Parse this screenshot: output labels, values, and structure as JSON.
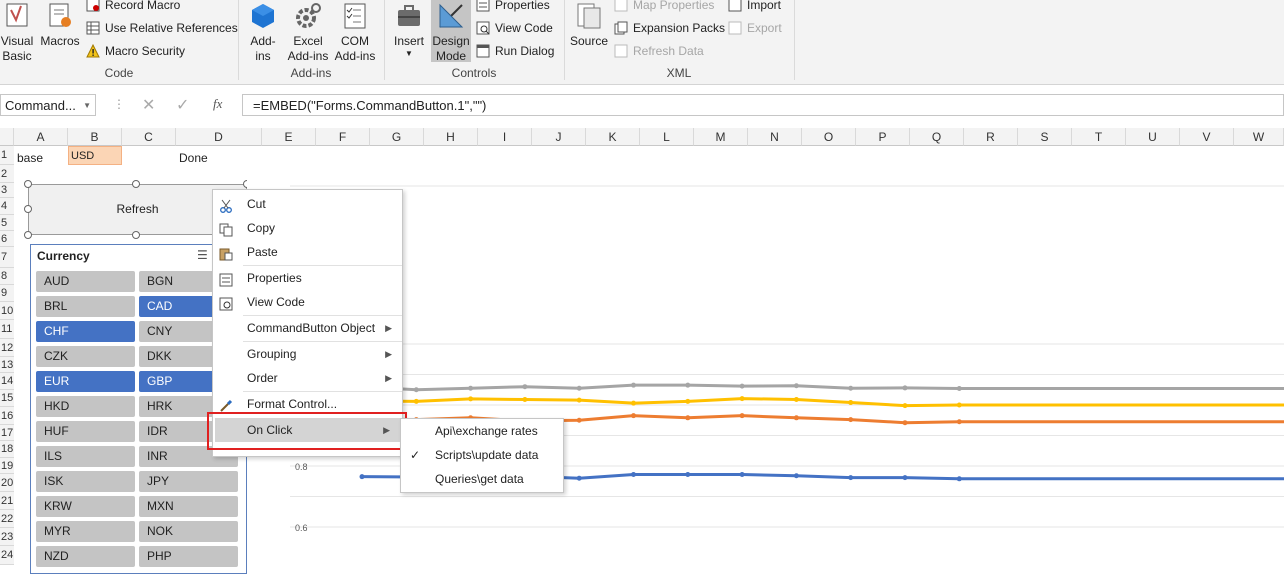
{
  "ribbon": {
    "code": {
      "label": "Code",
      "visual_basic": "Visual\nBasic",
      "macros": "Macros",
      "record_macro": "Record Macro",
      "use_relative_references": "Use Relative References",
      "macro_security": "Macro Security"
    },
    "addins": {
      "label": "Add-ins",
      "addins": "Add-\nins",
      "excel_addins": "Excel\nAdd-ins",
      "com_addins": "COM\nAdd-ins"
    },
    "controls": {
      "label": "Controls",
      "insert": "Insert",
      "design_mode": "Design\nMode",
      "properties": "Properties",
      "view_code": "View Code",
      "run_dialog": "Run Dialog"
    },
    "xml": {
      "label": "XML",
      "source": "Source",
      "map_properties": "Map Properties",
      "expansion_packs": "Expansion Packs",
      "refresh_data": "Refresh Data",
      "import": "Import",
      "export": "Export"
    }
  },
  "formula_bar": {
    "name_box": "Command...",
    "fx": "fx",
    "formula": "=EMBED(\"Forms.CommandButton.1\",\"\")"
  },
  "columns": [
    "A",
    "B",
    "C",
    "D",
    "E",
    "F",
    "G",
    "H",
    "I",
    "J",
    "K",
    "L",
    "M",
    "N",
    "O",
    "P",
    "Q",
    "R",
    "S",
    "T",
    "U",
    "V",
    "W"
  ],
  "rows": [
    "1",
    "2",
    "3",
    "4",
    "5",
    "6",
    "7",
    "8",
    "9",
    "10",
    "11",
    "12",
    "13",
    "14",
    "15",
    "16",
    "17",
    "18",
    "19",
    "20",
    "21",
    "22",
    "23",
    "24"
  ],
  "cells": {
    "a1": "base",
    "b1": "USD",
    "d1": "Done"
  },
  "button": {
    "label": "Refresh"
  },
  "slicer": {
    "title": "Currency",
    "items": [
      {
        "label": "AUD",
        "selected": false
      },
      {
        "label": "BGN",
        "selected": false
      },
      {
        "label": "BRL",
        "selected": false
      },
      {
        "label": "CAD",
        "selected": true
      },
      {
        "label": "CHF",
        "selected": true
      },
      {
        "label": "CNY",
        "selected": false
      },
      {
        "label": "CZK",
        "selected": false
      },
      {
        "label": "DKK",
        "selected": false
      },
      {
        "label": "EUR",
        "selected": true
      },
      {
        "label": "GBP",
        "selected": true
      },
      {
        "label": "HKD",
        "selected": false
      },
      {
        "label": "HRK",
        "selected": false
      },
      {
        "label": "HUF",
        "selected": false
      },
      {
        "label": "IDR",
        "selected": false
      },
      {
        "label": "ILS",
        "selected": false
      },
      {
        "label": "INR",
        "selected": false
      },
      {
        "label": "ISK",
        "selected": false
      },
      {
        "label": "JPY",
        "selected": false
      },
      {
        "label": "KRW",
        "selected": false
      },
      {
        "label": "MXN",
        "selected": false
      },
      {
        "label": "MYR",
        "selected": false
      },
      {
        "label": "NOK",
        "selected": false
      },
      {
        "label": "NZD",
        "selected": false
      },
      {
        "label": "PHP",
        "selected": false
      }
    ]
  },
  "context_menu": {
    "items": [
      "Cut",
      "Copy",
      "Paste",
      "Properties",
      "View Code",
      "CommandButton Object",
      "Grouping",
      "Order",
      "Format Control...",
      "On Click"
    ]
  },
  "submenu": {
    "items": [
      {
        "label": "Api\\exchange rates",
        "checked": false
      },
      {
        "label": "Scripts\\update data",
        "checked": true
      },
      {
        "label": "Queries\\get data",
        "checked": false
      }
    ]
  },
  "chart_data": {
    "type": "line",
    "y_tick_labels": [
      "0.8",
      "0.6"
    ],
    "series": [
      {
        "color": "#a5a5a5",
        "values": [
          1.06,
          1.05,
          1.055,
          1.06,
          1.055,
          1.065,
          1.065,
          1.062,
          1.063,
          1.055,
          1.056,
          1.054
        ]
      },
      {
        "color": "#ffc000",
        "values": [
          1.013,
          1.012,
          1.02,
          1.018,
          1.016,
          1.006,
          1.012,
          1.021,
          1.018,
          1.008,
          0.998,
          1.0
        ]
      },
      {
        "color": "#ed7d31",
        "values": [
          0.955,
          0.952,
          0.958,
          0.948,
          0.95,
          0.965,
          0.958,
          0.965,
          0.958,
          0.952,
          0.942,
          0.945
        ]
      },
      {
        "color": "#4472c4",
        "values": [
          0.765,
          0.764,
          0.763,
          0.767,
          0.76,
          0.772,
          0.772,
          0.772,
          0.768,
          0.762,
          0.762,
          0.758
        ]
      }
    ]
  },
  "colors": {
    "accent": "#4472c4",
    "highlight_box": "#e02020",
    "b1_fill": "#fbd5b5"
  }
}
